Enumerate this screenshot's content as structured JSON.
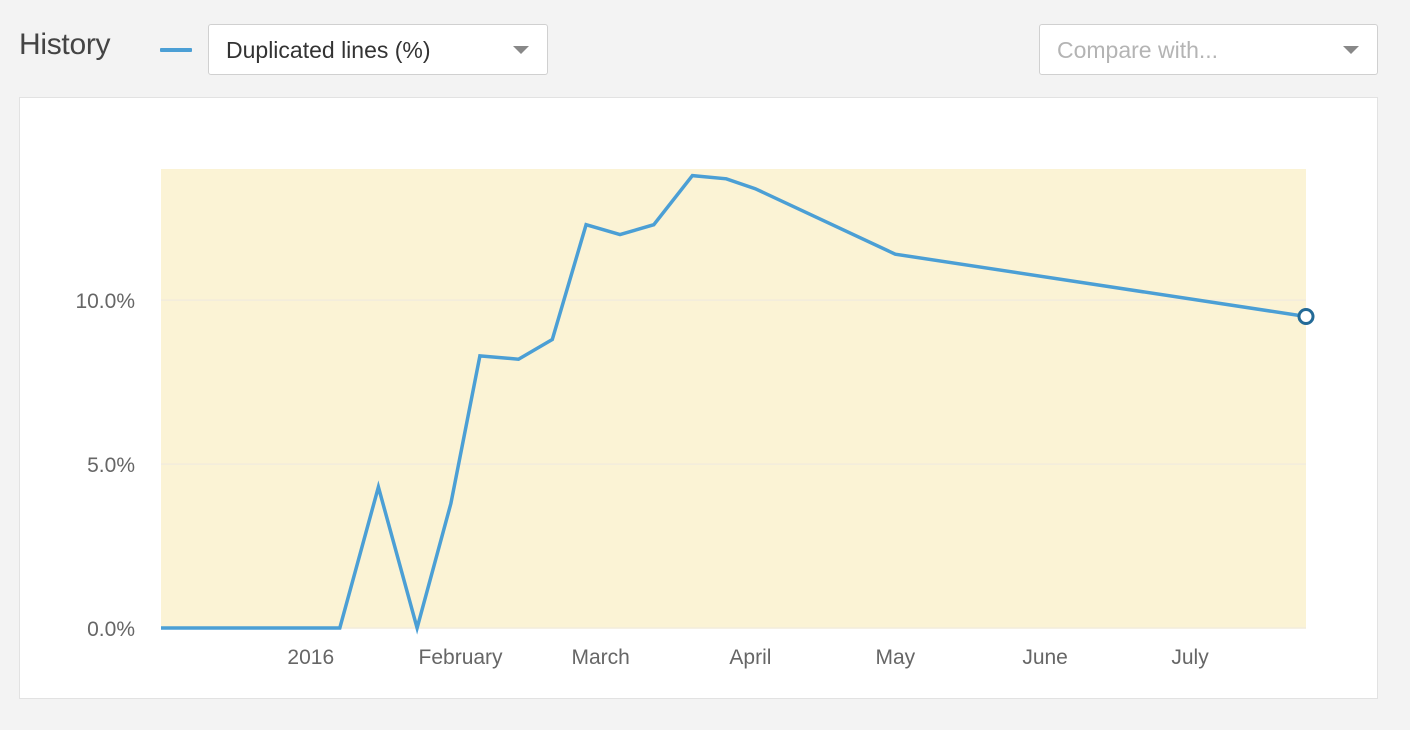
{
  "header": {
    "title": "History",
    "metric_select": {
      "selected": "Duplicated lines (%)"
    },
    "compare_select": {
      "placeholder": "Compare with..."
    }
  },
  "colors": {
    "series": "#4b9fd5",
    "series_dark": "#236a97",
    "plot_background": "#fbf3d5",
    "grid": "#f2ecdc"
  },
  "chart_data": {
    "type": "line",
    "series": [
      {
        "points": [
          {
            "x": "2015-12-01",
            "y": 0.0
          },
          {
            "x": "2016-01-07",
            "y": 0.0
          },
          {
            "x": "2016-01-15",
            "y": 4.3
          },
          {
            "x": "2016-01-23",
            "y": 0.0
          },
          {
            "x": "2016-01-30",
            "y": 3.8
          },
          {
            "x": "2016-02-05",
            "y": 8.3
          },
          {
            "x": "2016-02-13",
            "y": 8.2
          },
          {
            "x": "2016-02-20",
            "y": 8.8
          },
          {
            "x": "2016-02-27",
            "y": 12.3
          },
          {
            "x": "2016-03-05",
            "y": 12.0
          },
          {
            "x": "2016-03-12",
            "y": 12.3
          },
          {
            "x": "2016-03-20",
            "y": 13.8
          },
          {
            "x": "2016-03-27",
            "y": 13.7
          },
          {
            "x": "2016-04-02",
            "y": 13.4
          },
          {
            "x": "2016-05-01",
            "y": 11.4
          },
          {
            "x": "2016-07-25",
            "y": 9.5
          }
        ]
      }
    ],
    "x_ticks": [
      {
        "label": "2016",
        "date": "2016-01-01"
      },
      {
        "label": "February",
        "date": "2016-02-01"
      },
      {
        "label": "March",
        "date": "2016-03-01"
      },
      {
        "label": "April",
        "date": "2016-04-01"
      },
      {
        "label": "May",
        "date": "2016-05-01"
      },
      {
        "label": "June",
        "date": "2016-06-01"
      },
      {
        "label": "July",
        "date": "2016-07-01"
      }
    ],
    "y_ticks": [
      {
        "label": "0.0%",
        "value": 0
      },
      {
        "label": "5.0%",
        "value": 5
      },
      {
        "label": "10.0%",
        "value": 10
      }
    ],
    "xlim": [
      "2015-12-01",
      "2016-07-25"
    ],
    "ylim": [
      0,
      14
    ],
    "grid": true,
    "legend": "top-left"
  }
}
